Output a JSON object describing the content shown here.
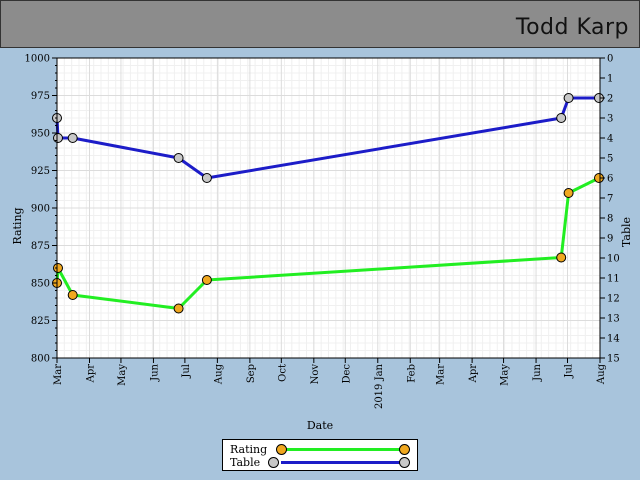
{
  "header": {
    "player_name": "Todd Karp"
  },
  "colors": {
    "rating": "#22ee22",
    "table": "#1c1cc8",
    "rating_marker": "#f0a820",
    "table_marker": "#c8c8c8"
  },
  "chart_data": {
    "type": "line",
    "xlabel": "Date",
    "ylabel": "Rating",
    "y2label": "Table",
    "x_range": [
      "2018-03-01",
      "2019-08-01"
    ],
    "x_ticks": [
      {
        "date": "2018-03-01",
        "label": "Mar"
      },
      {
        "date": "2018-04-01",
        "label": "Apr"
      },
      {
        "date": "2018-05-01",
        "label": "May"
      },
      {
        "date": "2018-06-01",
        "label": "Jun"
      },
      {
        "date": "2018-07-01",
        "label": "Jul"
      },
      {
        "date": "2018-08-01",
        "label": "Aug"
      },
      {
        "date": "2018-09-01",
        "label": "Sep"
      },
      {
        "date": "2018-10-01",
        "label": "Oct"
      },
      {
        "date": "2018-11-01",
        "label": "Nov"
      },
      {
        "date": "2018-12-01",
        "label": "Dec"
      },
      {
        "date": "2019-01-01",
        "label": "2019 Jan"
      },
      {
        "date": "2019-02-01",
        "label": "Feb"
      },
      {
        "date": "2019-03-01",
        "label": "Mar"
      },
      {
        "date": "2019-04-01",
        "label": "Apr"
      },
      {
        "date": "2019-05-01",
        "label": "May"
      },
      {
        "date": "2019-06-01",
        "label": "Jun"
      },
      {
        "date": "2019-07-01",
        "label": "Jul"
      },
      {
        "date": "2019-08-01",
        "label": "Aug"
      }
    ],
    "y_left": {
      "min": 800,
      "max": 1000,
      "ticks": [
        800,
        825,
        850,
        875,
        900,
        925,
        950,
        975,
        1000
      ]
    },
    "y_right": {
      "min": 0,
      "max": 15,
      "inverted": true,
      "ticks": [
        0,
        1,
        2,
        3,
        4,
        5,
        6,
        7,
        8,
        9,
        10,
        11,
        12,
        13,
        14,
        15
      ]
    },
    "grid": true,
    "legend_position": "bottom",
    "series": [
      {
        "name": "Rating",
        "axis": "left",
        "points": [
          {
            "x": "2018-03-01",
            "y": 850
          },
          {
            "x": "2018-03-02",
            "y": 860
          },
          {
            "x": "2018-03-16",
            "y": 842
          },
          {
            "x": "2018-06-25",
            "y": 833
          },
          {
            "x": "2018-07-22",
            "y": 852
          },
          {
            "x": "2019-06-25",
            "y": 867
          },
          {
            "x": "2019-07-02",
            "y": 910
          },
          {
            "x": "2019-07-31",
            "y": 920
          }
        ]
      },
      {
        "name": "Table",
        "axis": "right",
        "points": [
          {
            "x": "2018-03-01",
            "y": 3
          },
          {
            "x": "2018-03-02",
            "y": 4
          },
          {
            "x": "2018-03-16",
            "y": 4
          },
          {
            "x": "2018-06-25",
            "y": 5
          },
          {
            "x": "2018-07-22",
            "y": 6
          },
          {
            "x": "2019-06-25",
            "y": 3
          },
          {
            "x": "2019-07-02",
            "y": 2
          },
          {
            "x": "2019-07-31",
            "y": 2
          }
        ]
      }
    ]
  }
}
